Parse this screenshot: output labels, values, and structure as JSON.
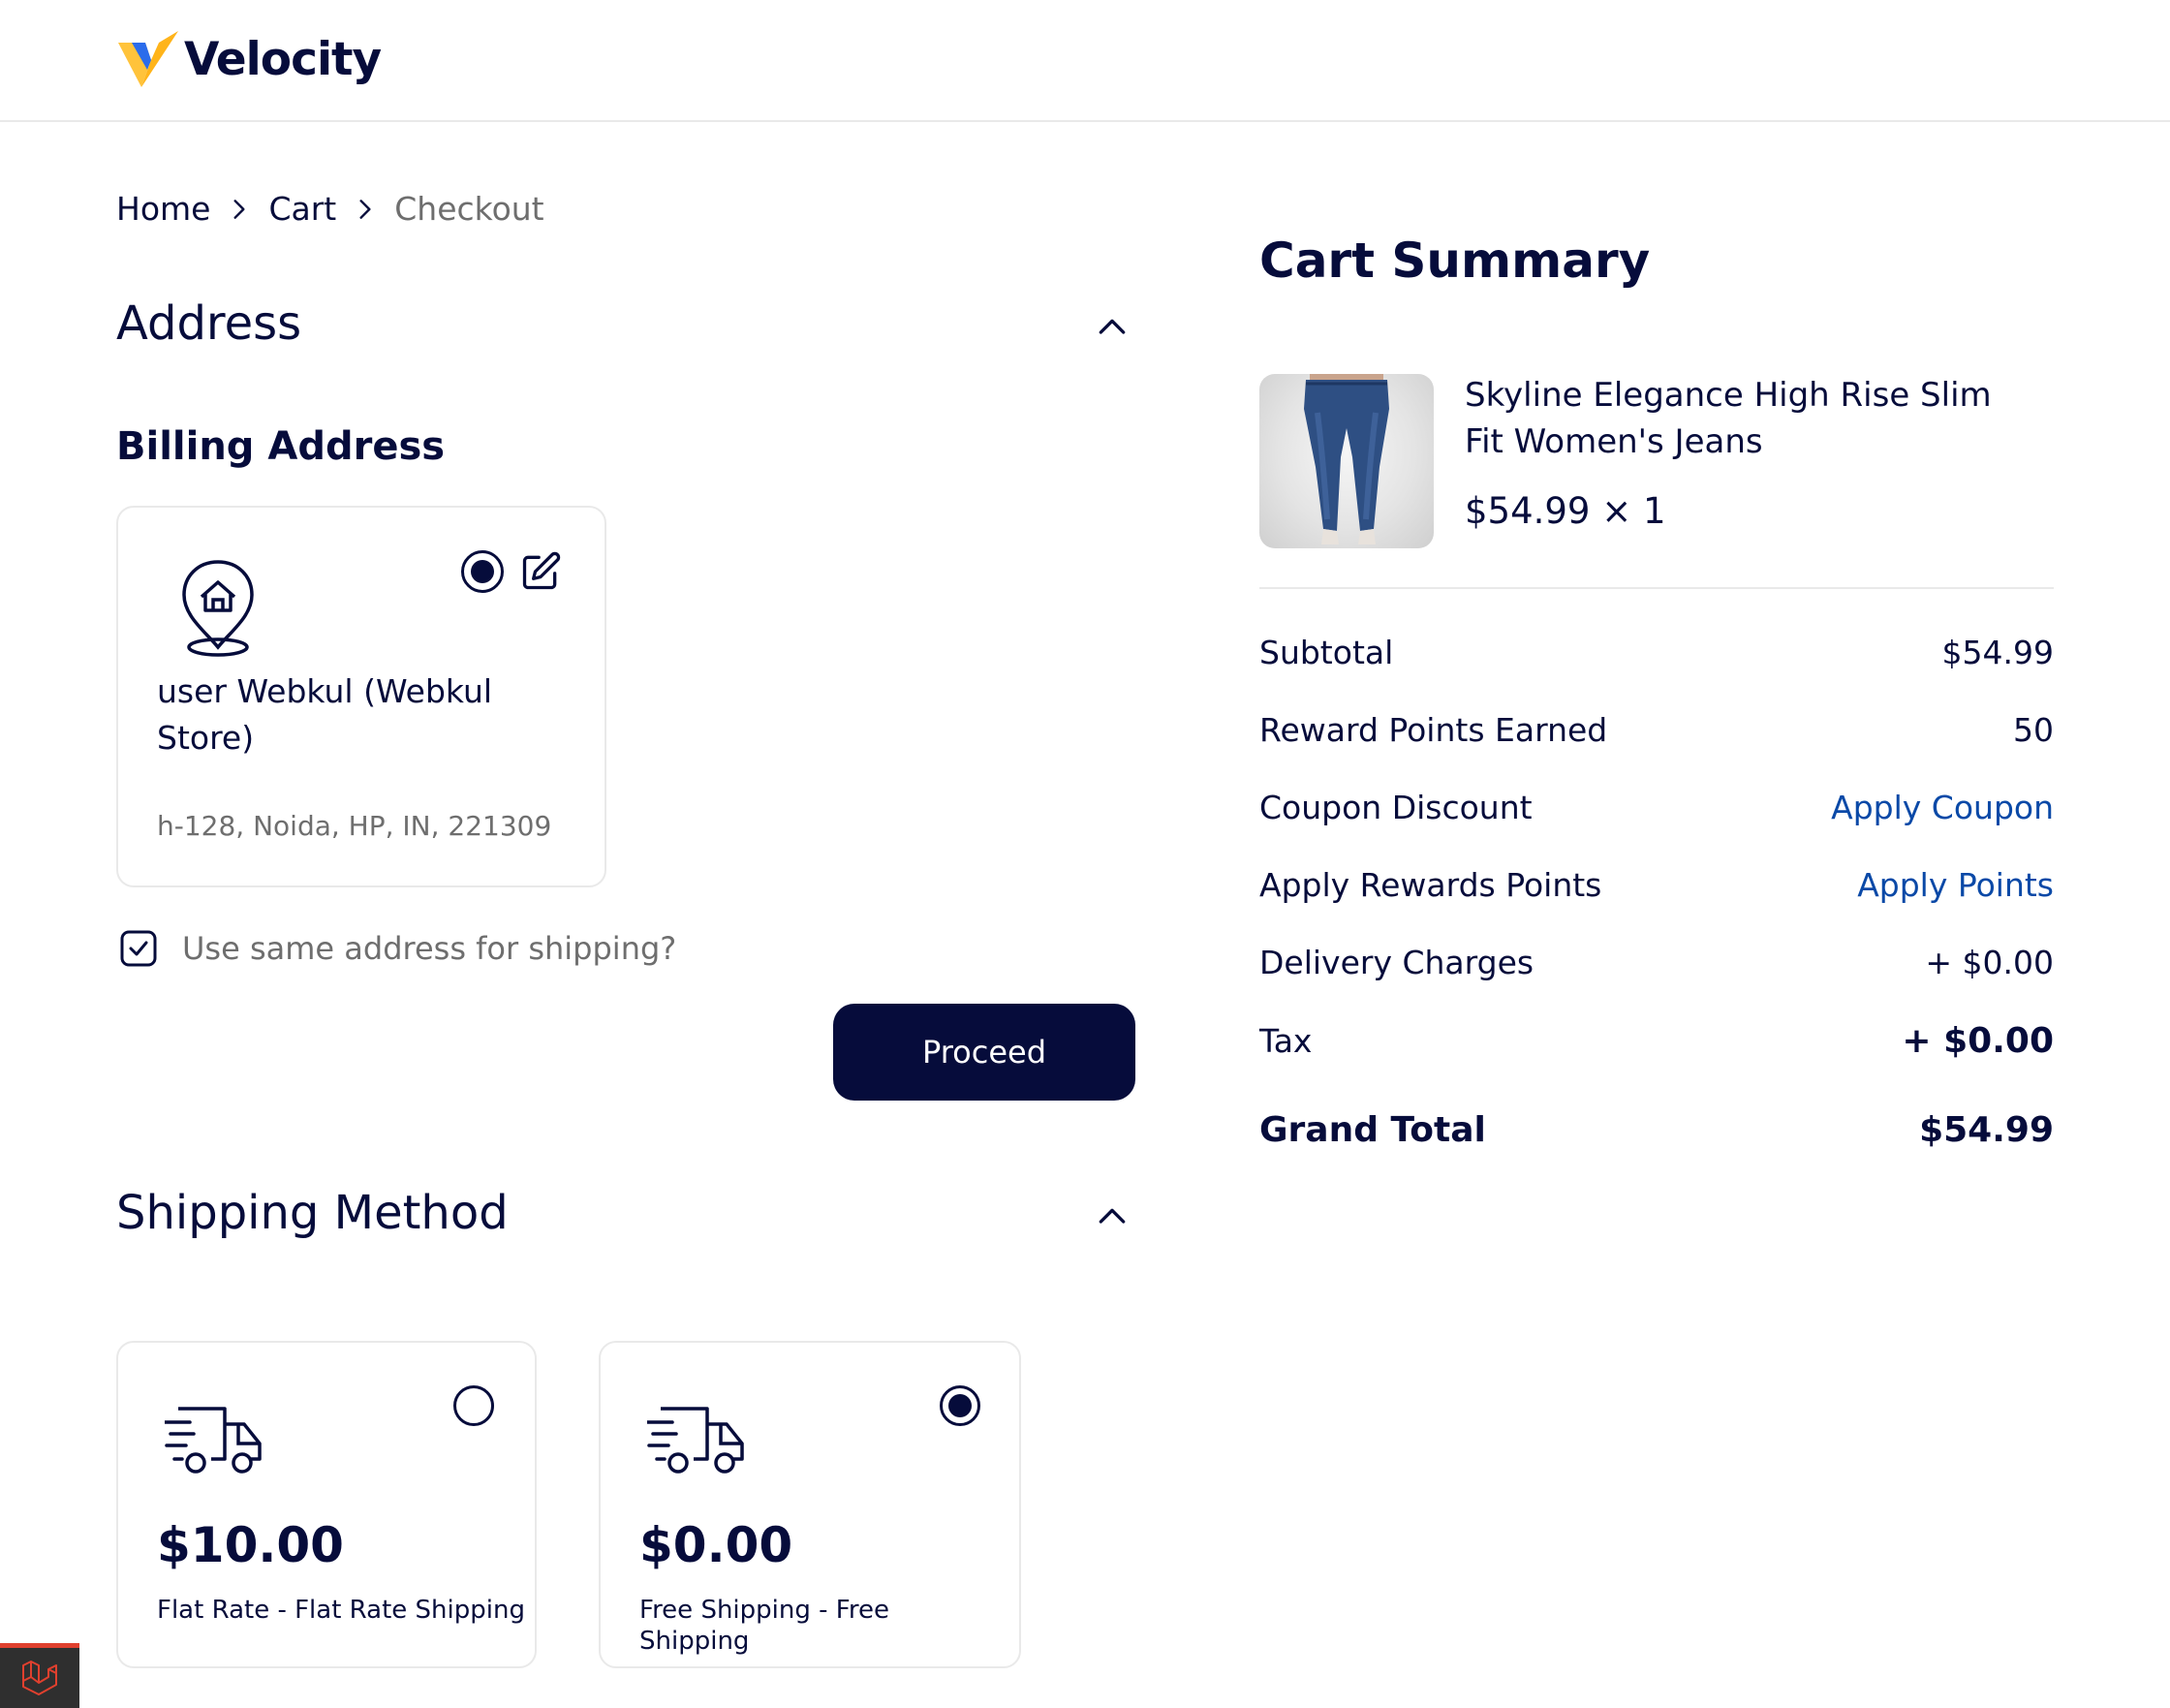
{
  "header": {
    "brand": "Velocity"
  },
  "breadcrumb": {
    "items": [
      "Home",
      "Cart",
      "Checkout"
    ]
  },
  "address": {
    "section_title": "Address",
    "billing_title": "Billing Address",
    "card": {
      "name": "user Webkul (Webkul Store)",
      "line": "h-128, Noida, HP, IN, 221309"
    },
    "same_address_label": "Use same address for shipping?",
    "proceed_label": "Proceed"
  },
  "shipping": {
    "section_title": "Shipping Method",
    "options": [
      {
        "price": "$10.00",
        "label": "Flat Rate - Flat Rate Shipping",
        "selected": false
      },
      {
        "price": "$0.00",
        "label": "Free Shipping - Free Shipping",
        "selected": true
      }
    ]
  },
  "summary": {
    "title": "Cart Summary",
    "product": {
      "name": "Skyline Elegance High Rise Slim Fit Women's Jeans",
      "price_qty": "$54.99 × 1"
    },
    "rows": {
      "subtotal_label": "Subtotal",
      "subtotal_value": "$54.99",
      "reward_label": "Reward Points Earned",
      "reward_value": "50",
      "coupon_label": "Coupon Discount",
      "coupon_action": "Apply Coupon",
      "points_label": "Apply Rewards Points",
      "points_action": "Apply Points",
      "delivery_label": "Delivery Charges",
      "delivery_value": "+ $0.00",
      "tax_label": "Tax",
      "tax_value": "+ $0.00",
      "grand_label": "Grand Total",
      "grand_value": "$54.99"
    }
  },
  "colors": {
    "primary": "#060C3B",
    "link": "#0A49A7",
    "muted": "#6E6E6E",
    "border": "#E9E9E9",
    "logo_yellow": "#FFC33B",
    "logo_blue": "#2B6CEB"
  }
}
